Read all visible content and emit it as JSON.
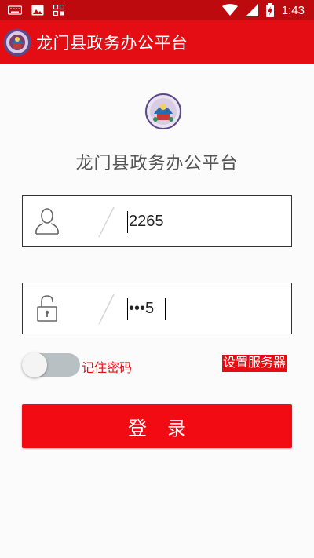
{
  "status_bar": {
    "time": "1:43",
    "left_icons": [
      "keyboard-icon",
      "image-icon",
      "grid-icon"
    ],
    "right_icons": [
      "wifi-icon",
      "signal-icon",
      "battery-charging-icon"
    ]
  },
  "app_bar": {
    "title": "龙门县政务办公平台"
  },
  "login": {
    "heading": "龙门县政务办公平台",
    "username_value": "2265",
    "password_value": "•••5",
    "remember_label": "记住密码",
    "remember_checked": false,
    "server_button_label": "设置服务器",
    "login_button_label": "登录"
  },
  "colors": {
    "status_bar": "#bd0a0e",
    "app_bar": "#e40d13",
    "primary_button": "#f30b14",
    "remember_text": "#e40d13"
  }
}
